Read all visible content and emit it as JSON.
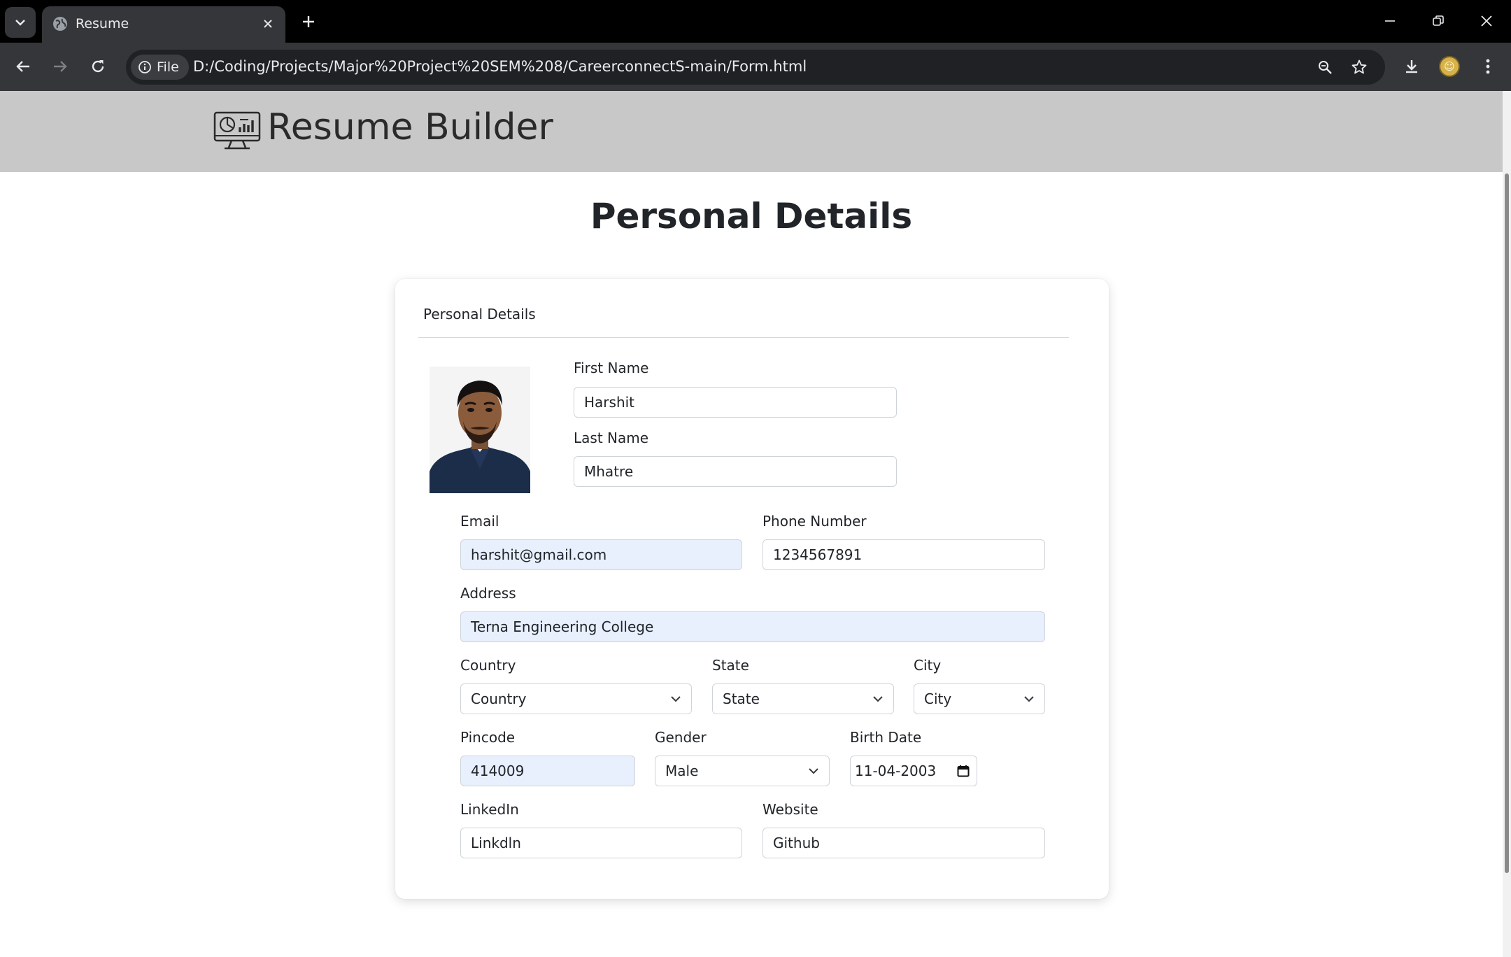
{
  "browser": {
    "tab_title": "Resume",
    "file_chip": "File",
    "url": "D:/Coding/Projects/Major%20Project%20SEM%208/CareerconnectS-main/Form.html"
  },
  "site": {
    "title": "Resume Builder"
  },
  "page": {
    "heading": "Personal Details"
  },
  "card": {
    "title": "Personal Details",
    "photo_alt": "profile photo",
    "fields": {
      "first_name": {
        "label": "First Name",
        "value": "Harshit"
      },
      "last_name": {
        "label": "Last Name",
        "value": "Mhatre"
      },
      "email": {
        "label": "Email",
        "value": "harshit@gmail.com"
      },
      "phone": {
        "label": "Phone Number",
        "value": "1234567891"
      },
      "address": {
        "label": "Address",
        "value": "Terna Engineering College"
      },
      "country": {
        "label": "Country",
        "value": "Country"
      },
      "state": {
        "label": "State",
        "value": "State"
      },
      "city": {
        "label": "City",
        "value": "City"
      },
      "pincode": {
        "label": "Pincode",
        "value": "414009"
      },
      "gender": {
        "label": "Gender",
        "value": "Male"
      },
      "birth_date": {
        "label": "Birth Date",
        "value": "11-04-2003"
      },
      "linkedin": {
        "label": "LinkedIn",
        "value": "Linkdln"
      },
      "website": {
        "label": "Website",
        "value": "Github"
      }
    }
  },
  "colors": {
    "header_bg": "#c8c8c8",
    "autofill_bg": "#e8f0fe",
    "chrome_dark": "#35363a"
  }
}
